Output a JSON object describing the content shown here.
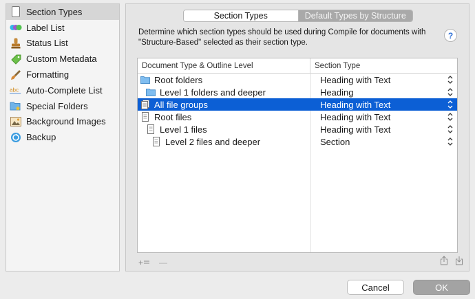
{
  "sidebar": {
    "items": [
      {
        "label": "Section Types",
        "icon": "document-icon",
        "selected": true
      },
      {
        "label": "Label List",
        "icon": "label-dots-icon",
        "selected": false
      },
      {
        "label": "Status List",
        "icon": "stamp-icon",
        "selected": false
      },
      {
        "label": "Custom Metadata",
        "icon": "tag-icon",
        "selected": false
      },
      {
        "label": "Formatting",
        "icon": "brush-icon",
        "selected": false
      },
      {
        "label": "Auto-Complete List",
        "icon": "abc-icon",
        "selected": false
      },
      {
        "label": "Special Folders",
        "icon": "special-folder-icon",
        "selected": false
      },
      {
        "label": "Background Images",
        "icon": "image-icon",
        "selected": false
      },
      {
        "label": "Backup",
        "icon": "backup-icon",
        "selected": false
      }
    ]
  },
  "tabs": {
    "section_types": "Section Types",
    "default_types": "Default Types by Structure"
  },
  "description": "Determine which section types should be used during Compile for documents with \"Structure-Based\" selected as their section type.",
  "help_label": "?",
  "table": {
    "headers": [
      "Document Type & Outline Level",
      "Section Type"
    ],
    "rows": [
      {
        "doc": "Root folders",
        "type": "Heading with Text",
        "icon": "folder-icon",
        "level": 0,
        "selected": false
      },
      {
        "doc": "Level 1 folders and deeper",
        "type": "Heading",
        "icon": "folder-icon",
        "level": 1,
        "selected": false
      },
      {
        "doc": "All file groups",
        "type": "Heading with Text",
        "icon": "file-group-icon",
        "level": 0,
        "selected": true
      },
      {
        "doc": "Root files",
        "type": "Heading with Text",
        "icon": "file-icon",
        "level": 0,
        "selected": false
      },
      {
        "doc": "Level 1 files",
        "type": "Heading with Text",
        "icon": "file-icon",
        "level": 1,
        "selected": false
      },
      {
        "doc": "Level 2 files and deeper",
        "type": "Section",
        "icon": "file-icon",
        "level": 2,
        "selected": false
      }
    ]
  },
  "tools": {
    "add_label": "+",
    "remove_label": "—"
  },
  "buttons": {
    "cancel": "Cancel",
    "ok": "OK"
  },
  "colors": {
    "selection": "#0c5fd5",
    "ok_button": "#a3a3a3",
    "tab_inactive": "#a9a9a9"
  }
}
